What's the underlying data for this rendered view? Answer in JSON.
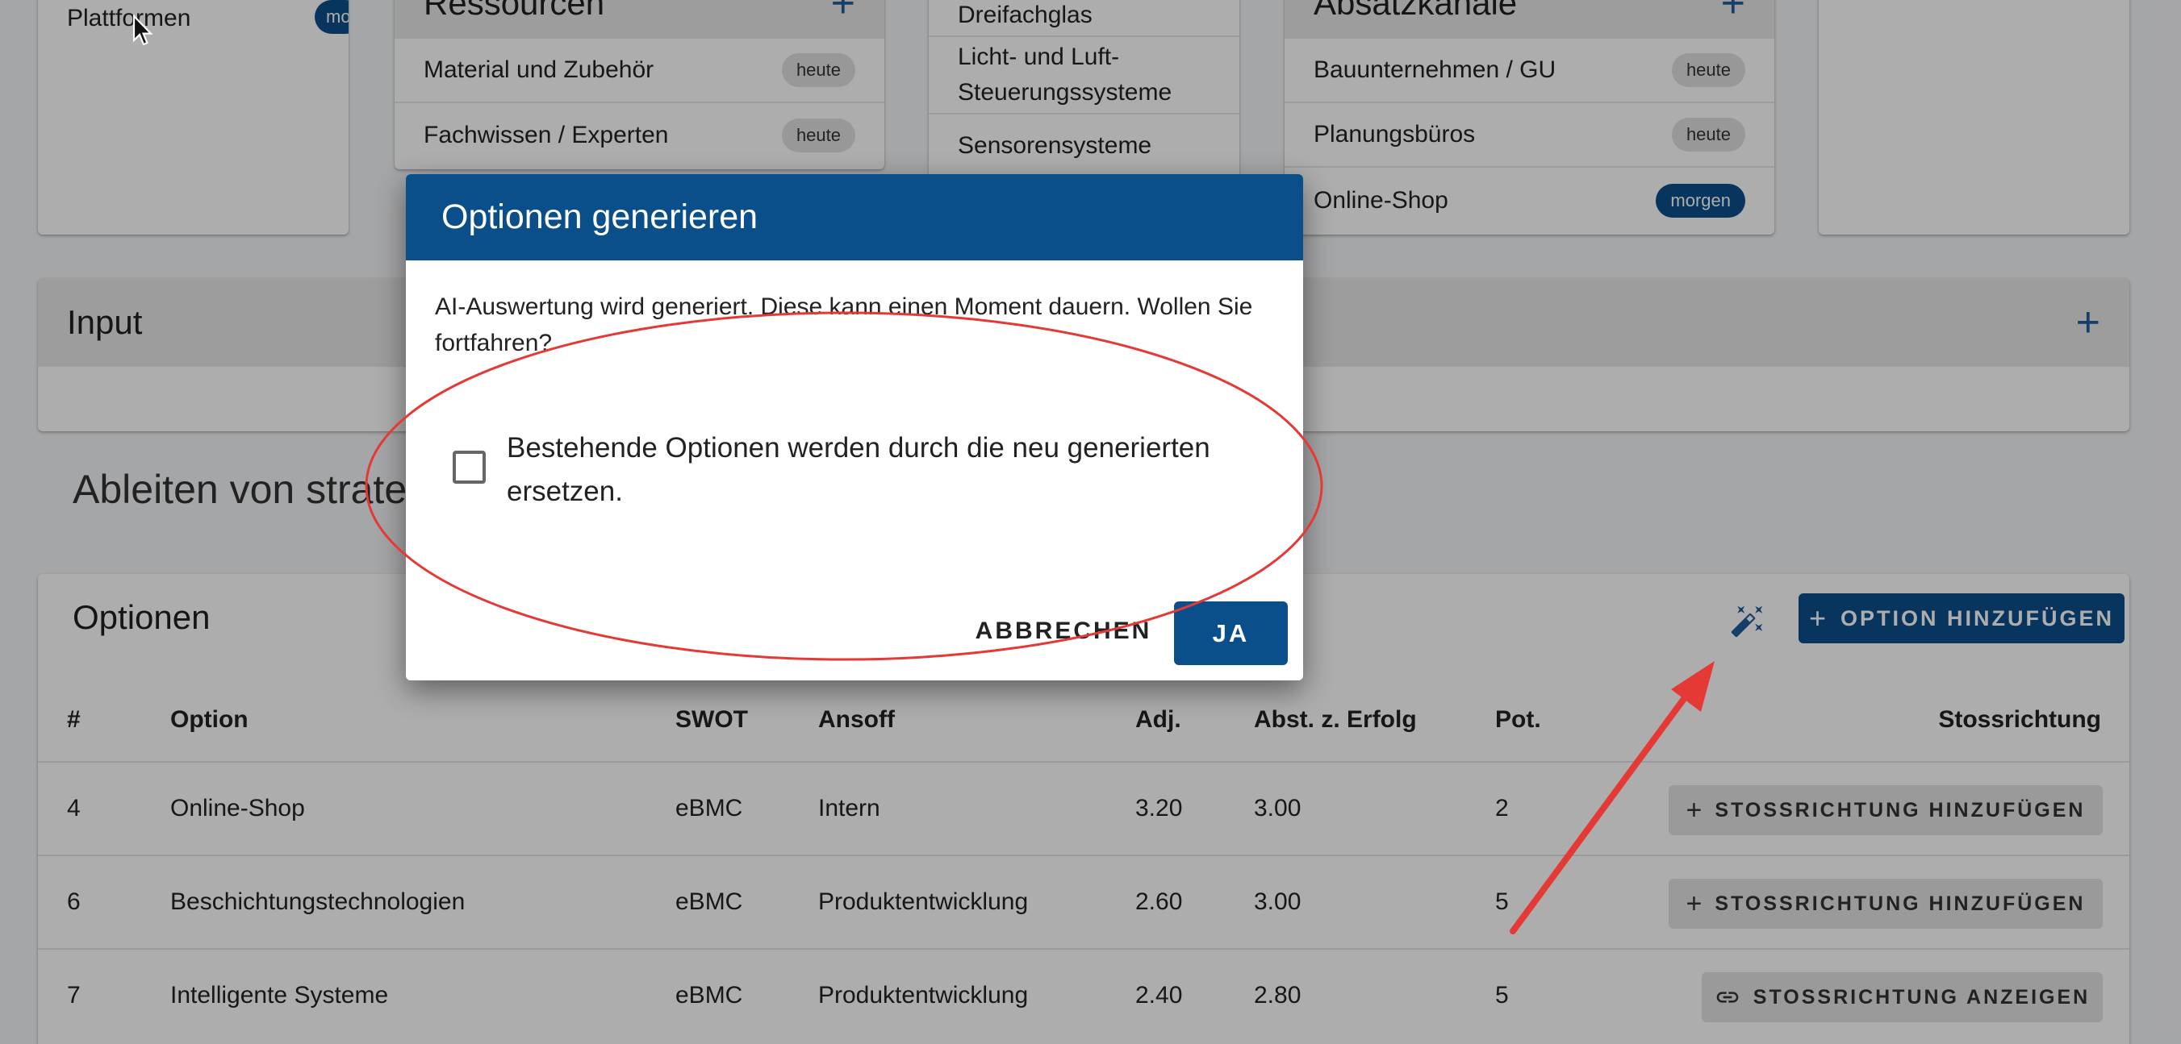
{
  "top_cards": {
    "plattformen": {
      "item_label": "Plattformen",
      "chip": "mo"
    },
    "ressourcen": {
      "title": "Ressourcen",
      "items": [
        {
          "label": "Material und Zubehör",
          "chip": "heute"
        },
        {
          "label": "Fachwissen / Experten",
          "chip": "heute"
        }
      ]
    },
    "middle": {
      "items": [
        {
          "label": "Dreifachglas"
        },
        {
          "label": "Licht- und Luft-\nSteuerungssysteme"
        },
        {
          "label": "Sensorensysteme"
        }
      ]
    },
    "absatzkanaele": {
      "title": "Absatzkanäle",
      "items": [
        {
          "label": "Bauunternehmen / GU",
          "chip": "heute"
        },
        {
          "label": "Planungsbüros",
          "chip": "heute"
        },
        {
          "label": "Online-Shop",
          "chip": "morgen"
        }
      ]
    }
  },
  "input_card": {
    "title": "Input"
  },
  "section": {
    "title": "Ableiten von strategischen Stossrichtungen"
  },
  "options_card": {
    "title": "Optionen",
    "add_button": "OPTION HINZUFÜGEN",
    "columns": [
      "#",
      "Option",
      "SWOT",
      "Ansoff",
      "Adj.",
      "Abst. z. Erfolg",
      "Pot.",
      "Stossrichtung"
    ],
    "rows": [
      {
        "num": "4",
        "option": "Online-Shop",
        "swot": "eBMC",
        "ansoff": "Intern",
        "adj": "3.20",
        "abst": "3.00",
        "pot": "2",
        "action": "STOSSRICHTUNG HINZUFÜGEN",
        "action_icon": "plus-icon"
      },
      {
        "num": "6",
        "option": "Beschichtungstechnologien",
        "swot": "eBMC",
        "ansoff": "Produktentwicklung",
        "adj": "2.60",
        "abst": "3.00",
        "pot": "5",
        "action": "STOSSRICHTUNG HINZUFÜGEN",
        "action_icon": "plus-icon"
      },
      {
        "num": "7",
        "option": "Intelligente Systeme",
        "swot": "eBMC",
        "ansoff": "Produktentwicklung",
        "adj": "2.40",
        "abst": "2.80",
        "pot": "5",
        "action": "STOSSRICHTUNG ANZEIGEN",
        "action_icon": "link-icon"
      }
    ]
  },
  "dialog": {
    "title": "Optionen generieren",
    "message": "AI-Auswertung wird generiert. Diese kann einen Moment dauern. Wollen Sie fortfahren?",
    "checkbox_label": "Bestehende Optionen werden durch die neu generierten ersetzen.",
    "checkbox_checked": false,
    "cancel": "ABBRECHEN",
    "confirm": "JA"
  },
  "colors": {
    "primary": "#0b4f8a",
    "annotation": "#e53935",
    "header_bg": "#e7e7e7"
  }
}
